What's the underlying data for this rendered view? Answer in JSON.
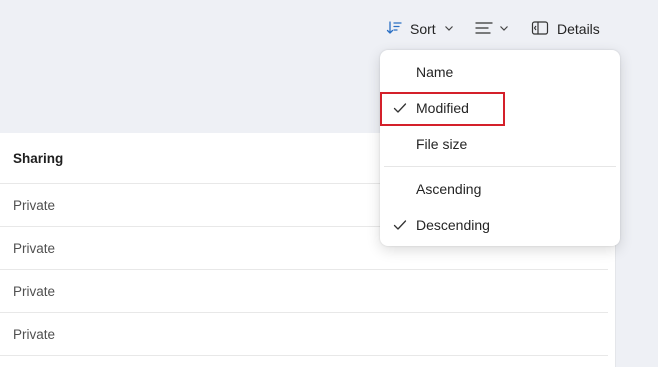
{
  "toolbar": {
    "sort_label": "Sort",
    "details_label": "Details"
  },
  "file_list": {
    "column_header": "Sharing",
    "rows": [
      "Private",
      "Private",
      "Private",
      "Private"
    ]
  },
  "sort_menu": {
    "items": [
      {
        "label": "Name",
        "checked": false
      },
      {
        "label": "Modified",
        "checked": true
      },
      {
        "label": "File size",
        "checked": false
      }
    ],
    "order": [
      {
        "label": "Ascending",
        "checked": false
      },
      {
        "label": "Descending",
        "checked": true
      }
    ],
    "highlighted_item": "Modified"
  },
  "colors": {
    "accent_blue": "#2a6fc4",
    "highlight_red": "#d4202a"
  },
  "icons": [
    "sort-icon",
    "chevron-down-icon",
    "view-list-icon",
    "details-pane-icon",
    "checkmark-icon"
  ]
}
